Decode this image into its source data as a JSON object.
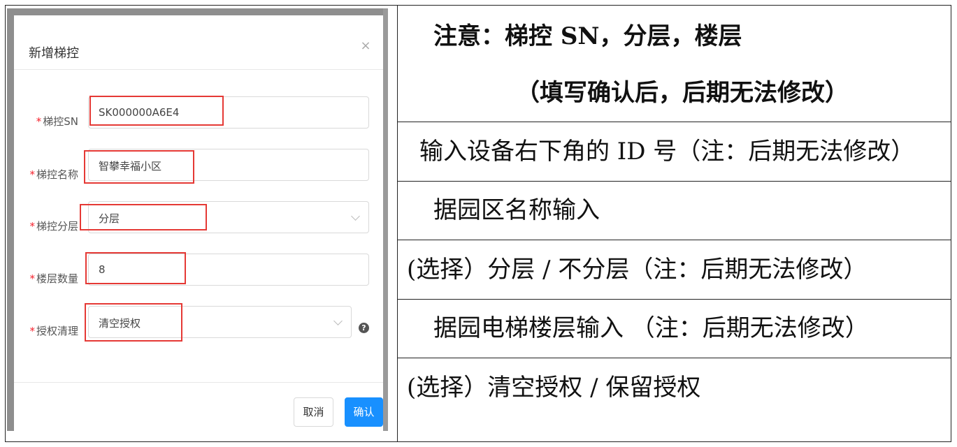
{
  "dialog": {
    "title": "新增梯控",
    "close_icon": "×",
    "fields": [
      {
        "label": "梯控SN",
        "value": "SK000000A6E4",
        "type": "input"
      },
      {
        "label": "梯控名称",
        "value": "智攀幸福小区",
        "type": "input"
      },
      {
        "label": "梯控分层",
        "value": "分层",
        "type": "select"
      },
      {
        "label": "楼层数量",
        "value": "8",
        "type": "input"
      },
      {
        "label": "授权清理",
        "value": "清空授权",
        "type": "select"
      }
    ],
    "required_mark": "*",
    "help_icon": "?",
    "cancel_label": "取消",
    "ok_label": "确认"
  },
  "notes": {
    "row1_line1": "注意：梯控 SN，分层，楼层",
    "row1_line2": "（填写确认后，后期无法修改）",
    "row2": "输入设备右下角的 ID 号（注：后期无法修改）",
    "row3": "据园区名称输入",
    "row4": "(选择）分层 /   不分层（注：后期无法修改）",
    "row5": "据园电梯楼层输入 （注：后期无法修改）",
    "row6": "(选择）清空授权   /   保留授权"
  },
  "colors": {
    "accent": "#1890ff",
    "highlight": "#e53935",
    "required": "#f5222d"
  }
}
